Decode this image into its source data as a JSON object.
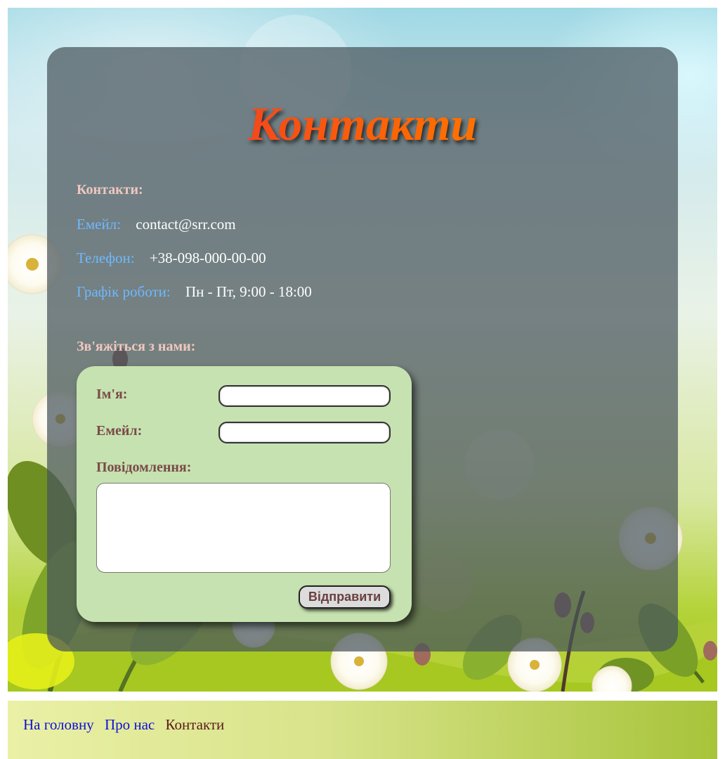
{
  "page": {
    "title": "Контакти"
  },
  "contacts": {
    "heading": "Контакти:",
    "email_label": "Емейл:",
    "email_value": "contact@srr.com",
    "phone_label": "Телефон:",
    "phone_value": "+38-098-000-00-00",
    "hours_label": "Графік роботи:",
    "hours_value": "Пн - Пт, 9:00 - 18:00"
  },
  "form": {
    "heading": "Зв'яжіться з нами:",
    "name_label": "Ім'я:",
    "name_value": "",
    "email_label": "Емейл:",
    "email_value": "",
    "message_label": "Повідомлення:",
    "message_value": "",
    "submit_label": "Відправити"
  },
  "nav": {
    "items": [
      {
        "label": "На головну",
        "current": false
      },
      {
        "label": "Про нас",
        "current": false
      },
      {
        "label": "Контакти",
        "current": true
      }
    ]
  },
  "colors": {
    "title_gradient_start": "#e8233a",
    "title_gradient_end": "#ff8c00",
    "label_blue": "#6fb8ff",
    "form_background": "#c6e2b0",
    "link_blue": "#0f0fd6"
  }
}
